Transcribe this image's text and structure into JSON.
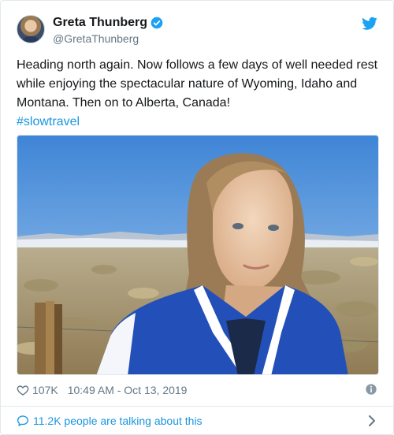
{
  "author": {
    "display_name": "Greta Thunberg",
    "handle": "@GretaThunberg",
    "verified": true
  },
  "tweet": {
    "text": "Heading north again. Now follows a few days of well needed rest while enjoying the spectacular nature of Wyoming, Idaho and Montana. Then on to Alberta, Canada!",
    "hashtag": "#slowtravel"
  },
  "stats": {
    "likes": "107K",
    "timestamp": "10:49 AM - Oct 13, 2019"
  },
  "conversation": {
    "label": "11.2K people are talking about this"
  },
  "icons": {
    "verified": "verified-badge-icon",
    "brand": "twitter-bird-icon",
    "like": "heart-icon",
    "info": "info-icon",
    "conversation": "speech-bubble-icon",
    "more": "chevron-right-icon"
  },
  "colors": {
    "brand_blue": "#1da1f2",
    "link_blue": "#1b95e0",
    "text": "#14171a",
    "muted": "#657786",
    "border": "#e1e8ed"
  }
}
